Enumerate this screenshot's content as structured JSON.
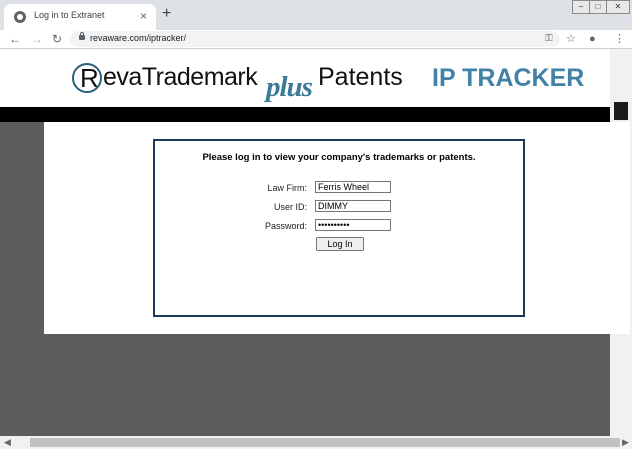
{
  "browser": {
    "tab_title": "Log in to Extranet",
    "tab_close": "×",
    "new_tab": "+",
    "url": "revaware.com/iptracker/",
    "icons": [
      "back-arrow-icon",
      "forward-arrow-icon",
      "reload-icon",
      "lock-icon",
      "key-icon",
      "star-icon",
      "profile-icon",
      "menu-icon"
    ]
  },
  "logo": {
    "r": "R",
    "rest": "evaTrademark",
    "plus": "plus",
    "patents": "Patents"
  },
  "header": {
    "product": "IP TRACKER"
  },
  "login": {
    "prompt": "Please log in to view your company's trademarks or patents.",
    "law_firm_label": "Law Firm:",
    "law_firm_value": "Ferris Wheel",
    "user_id_label": "User ID:",
    "user_id_value": "DIMMY",
    "password_label": "Password:",
    "password_value": "••••••••••",
    "button_label": "Log In"
  },
  "colors": {
    "accent": "#4282a6",
    "box_border": "#1e3a5a",
    "background": "#5d5d5d"
  }
}
